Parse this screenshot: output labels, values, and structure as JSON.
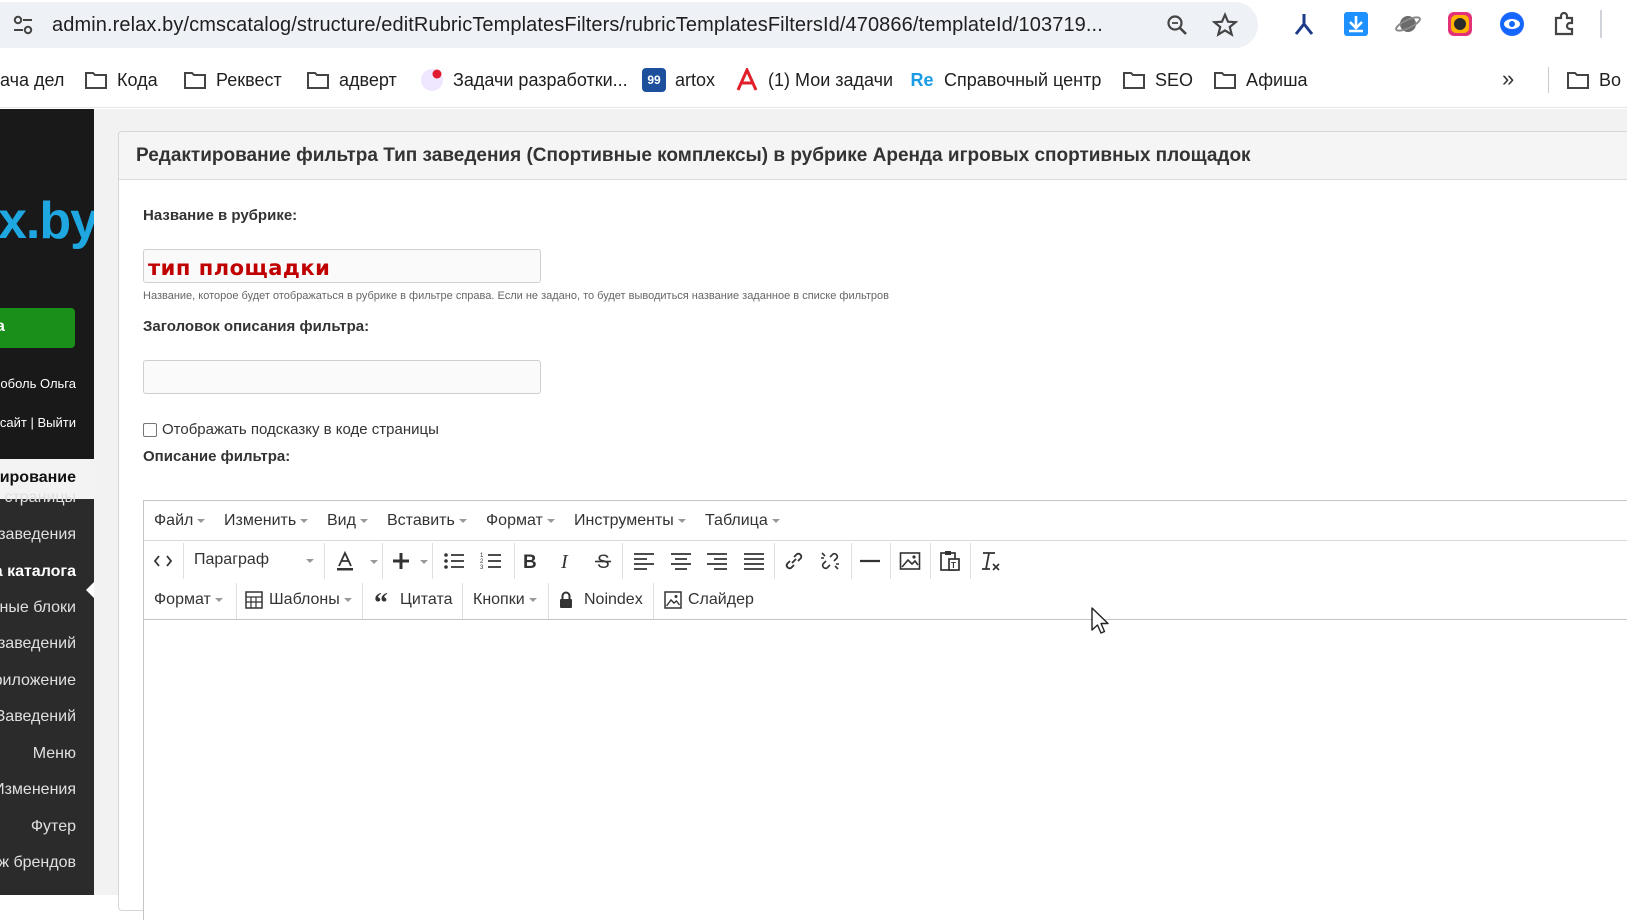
{
  "browser": {
    "url": "admin.relax.by/cmscatalog/structure/editRubricTemplatesFilters/rubricTemplatesFiltersId/470866/templateId/103719...",
    "bookmarks": [
      {
        "label": "ача дел",
        "icon": "none"
      },
      {
        "label": "Кода",
        "icon": "folder-icon"
      },
      {
        "label": "Реквест",
        "icon": "folder-icon"
      },
      {
        "label": "адверт",
        "icon": "folder-icon"
      },
      {
        "label": "Задачи разработки...",
        "icon": "tasks-dot-icon"
      },
      {
        "label": "artox",
        "icon": "artox-99-icon",
        "badge": "99"
      },
      {
        "label": "(1) Мои задачи",
        "icon": "red-a-icon"
      },
      {
        "label": "Справочный центр",
        "icon": "re-icon",
        "badge": "Re"
      },
      {
        "label": "SEO",
        "icon": "folder-icon"
      },
      {
        "label": "Афиша",
        "icon": "folder-icon"
      },
      {
        "label": "Во",
        "icon": "folder-icon"
      }
    ],
    "more_bookmarks": "»"
  },
  "sidebar": {
    "logo": "x.by",
    "green_button": "a",
    "user_name": "оболь Ольга",
    "user_link_site": "сайт",
    "user_link_sep": "|",
    "user_link_logout": "Выйти",
    "active_section": "ирование",
    "items": [
      "е страницы",
      "заведения",
      "а каталога",
      "ные блоки",
      "заведений",
      "риложение",
      "Заведений",
      "Меню",
      "Изменения",
      "Футер",
      "ж брендов"
    ],
    "current_item_index": 2
  },
  "page": {
    "title": "Редактирование фильтра Тип заведения (Спортивные комплексы) в рубрике Аренда игровых спортивных площадок",
    "name_label": "Название в рубрике:",
    "name_value": "тип площадки",
    "name_help": "Название, которое будет отображаться в рубрике в фильтре справа. Если не задано, то будет выводиться название заданное в списке фильтров",
    "desc_title_label": "Заголовок описания фильтра:",
    "desc_title_value": "",
    "show_hint_label": "Отображать подсказку в коде страницы",
    "show_hint_checked": false,
    "description_label": "Описание фильтра:"
  },
  "editor": {
    "menu": [
      "Файл",
      "Изменить",
      "Вид",
      "Вставить",
      "Формат",
      "Инструменты",
      "Таблица"
    ],
    "paragraph_select": "Параграф",
    "row3": {
      "format": "Формат",
      "templates": "Шаблоны",
      "quote": "Цитата",
      "buttons": "Кнопки",
      "noindex": "Noindex",
      "slider": "Слайдер"
    }
  },
  "colors": {
    "sidebar_dark": "#191919",
    "sidebar": "#2b2b2b",
    "logo_blue": "#1ea7e1",
    "green_button": "#1a8f1a",
    "name_value_red": "#c00000"
  }
}
